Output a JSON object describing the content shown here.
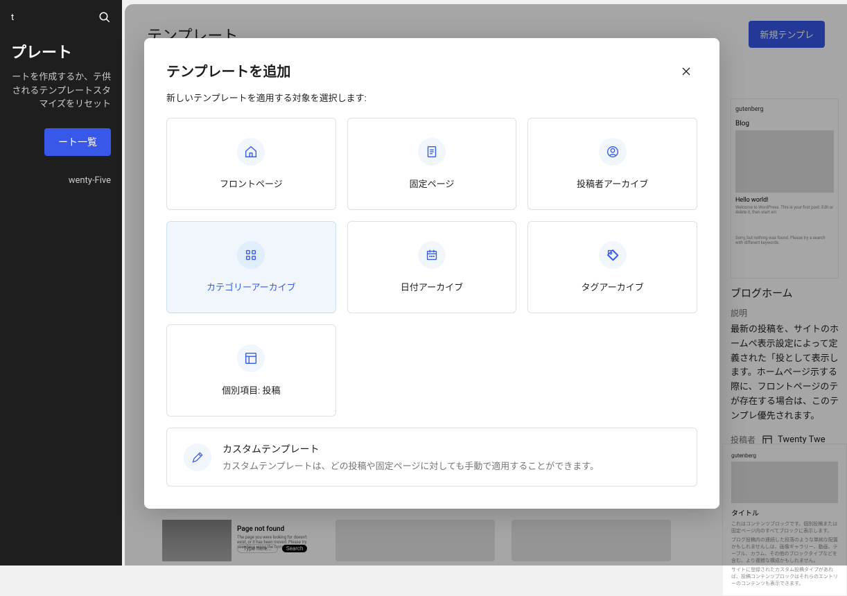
{
  "sidebar": {
    "top_label": "t",
    "heading": "プレート",
    "description": "ートを作成するか、テ供されるテンプレートスタマイズをリセット",
    "button": "ート一覧",
    "theme": "wenty-Five"
  },
  "header": {
    "title": "テンプレート",
    "new_button": "新規テンプレ"
  },
  "modal": {
    "title": "テンプレートを追加",
    "subtitle": "新しいテンプレートを適用する対象を選択します:",
    "cards": [
      {
        "label": "フロントページ",
        "icon": "home"
      },
      {
        "label": "固定ページ",
        "icon": "page"
      },
      {
        "label": "投稿者アーカイブ",
        "icon": "author"
      },
      {
        "label": "カテゴリーアーカイブ",
        "icon": "category"
      },
      {
        "label": "日付アーカイブ",
        "icon": "date"
      },
      {
        "label": "タグアーカイブ",
        "icon": "tag"
      },
      {
        "label": "個別項目: 投稿",
        "icon": "layout"
      }
    ],
    "custom": {
      "title": "カスタムテンプレート",
      "description": "カスタムテンプレートは、どの投稿や固定ページに対しても手動で適用することができます。"
    }
  },
  "right": {
    "preview_site": "gutenberg",
    "preview_blog": "Blog",
    "preview_hello": "Hello world!",
    "preview_welcome": "Welcome to WordPress. This is your first post. Edit or delete it, then start wri",
    "preview_sorry": "Sorry, but nothing was found. Please try a search with different keywords.",
    "label": "ブログホーム",
    "desc_heading": "説明",
    "description": "最新の投稿を、サイトのホームペ表示設定によって定義された「投として表示します。ホームページ示する際に、フロントページのテが存在する場合は、このテンプレ優先されます。",
    "author_label": "投稿者",
    "theme": "Twenty Twe",
    "preview2_site": "gutenberg",
    "preview2_title": "タイトル",
    "preview2_line1": "これはコンテンツブロックです。個別投稿または固定ページ内のすべてブロックに表示します。",
    "preview2_line2": "ブログ投稿内の連続した段落のような単純な配置かもしれませんしは、画像ギャラリー、動画、テーブル、カラム、その他のブロックタイプなどを含む、より複雑な構成かもしれません。",
    "preview2_line3": "サイトに登録されたカスタム投稿タイプがあれば、投稿コンテンツブロックはそれらのエントリーのコンテンツも表示できます。"
  },
  "thumb404": {
    "title": "Page not found",
    "desc": "The page you were looking for doesn't exist, or it has been moved. Please try searching using the form below.",
    "placeholder": "Type here...",
    "button": "Search"
  }
}
